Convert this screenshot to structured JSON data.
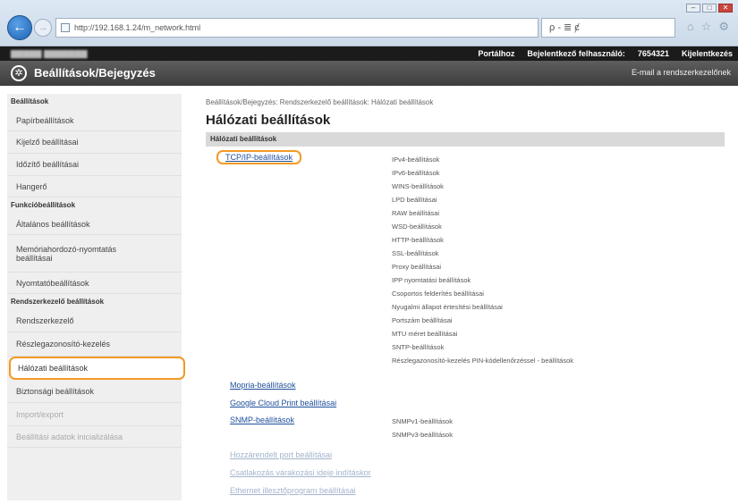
{
  "browser": {
    "url": "http://192.168.1.24/m_network.html",
    "toolbar_text": "ρ - ≣ ȼ",
    "window_min": "‒",
    "window_max": "□",
    "window_close": "✕"
  },
  "topbar": {
    "portal": "Portálhoz",
    "login_label": "Bejelentkező felhasználó:",
    "user_id": "7654321",
    "logout": "Kijelentkezés"
  },
  "titlebar": {
    "title": "Beállítások/Bejegyzés",
    "mail_link": "E-mail a rendszerkezelőnek"
  },
  "sidebar": {
    "cat_settings": "Beállítások",
    "item_paper": "Papírbeállítások",
    "item_display": "Kijelző beállításai",
    "item_timer": "Időzítő beállításai",
    "item_volume": "Hangerő",
    "cat_function": "Funkcióbeállítások",
    "item_general": "Általános beállítások",
    "item_media_1": "Memóriahordozó-nyomtatás",
    "item_media_2": "beállításai",
    "item_print": "Nyomtatóbeállítások",
    "cat_admin": "Rendszerkezelő beállítások",
    "item_sysadmin": "Rendszerkezelő",
    "item_dept": "Részlegazonosító-kezelés",
    "item_network": "Hálózati beállítások",
    "item_security": "Biztonsági beállítások",
    "item_import": "Import/export",
    "item_init": "Beállítási adatok inicializálása"
  },
  "main": {
    "breadcrumb": "Beállítások/Bejegyzés: Rendszerkezelő beállítások: Hálózati beállítások",
    "title": "Hálózati beállítások",
    "section": "Hálózati beállítások",
    "tcpip": "TCP/IP-beállítások",
    "tcpip_subs": [
      "IPv4-beállítások",
      "IPv6-beállítások",
      "WINS-beállítások",
      "LPD beállításai",
      "RAW beállításai",
      "WSD-beállítások",
      "HTTP-beállítások",
      "SSL-beállítások",
      "Proxy beállításai",
      "IPP nyomtatási beállítások",
      "Csoportos felderítés beállításai",
      "Nyugalmi állapot értesítési beállításai",
      "Portszám beállításai",
      "MTU méret beállításai",
      "SNTP-beállítások",
      "Részlegazonosító-kezelés PIN-kódellenőrzéssel - beállítások"
    ],
    "mopria": "Mopria-beállítások",
    "google": "Google Cloud Print beállításai",
    "snmp": "SNMP-beállítások",
    "snmp_subs": [
      "SNMPv1-beállítások",
      "SNMPv3-beállítások"
    ],
    "dedicated": "Hozzárendelt port beállításai",
    "waiting": "Csatlakozás várakozási ideje indításkor",
    "ethernet": "Ethernet illesztőprogram beállításai"
  }
}
